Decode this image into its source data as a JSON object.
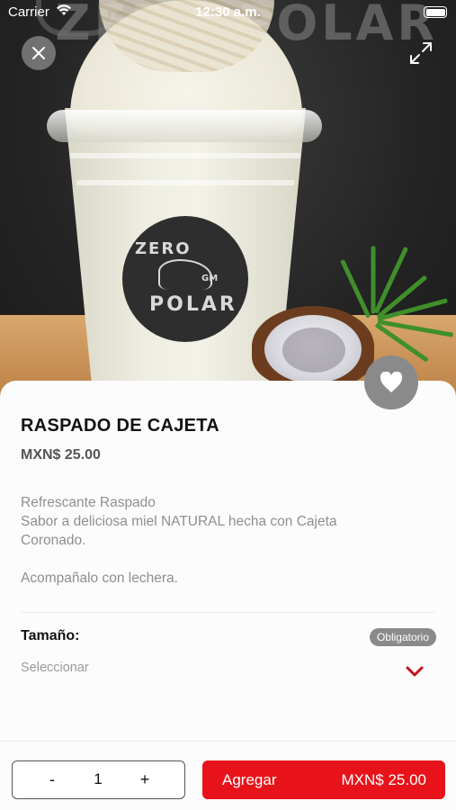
{
  "status_bar": {
    "carrier": "Carrier",
    "time": "12:30 a.m."
  },
  "product": {
    "name": "RASPADO DE CAJETA",
    "price": "MXN$ 25.00",
    "description_lines": [
      "Refrescante Raspado",
      "Sabor a deliciosa miel NATURAL hecha con Cajeta",
      "Coronado.",
      "",
      "Acompañalo con lechera."
    ],
    "image_logo_text": [
      "ZERO",
      "POLAR",
      "GM"
    ]
  },
  "options": {
    "size_label": "Tamaño:",
    "required_badge": "Obligatorio",
    "size_placeholder": "Seleccionar"
  },
  "cart": {
    "minus_label": "-",
    "quantity": "1",
    "plus_label": "+",
    "add_label": "Agregar",
    "add_amount": "MXN$ 25.00"
  },
  "colors": {
    "accent": "#e8131a",
    "badge_bg": "#8a8a8a",
    "chevron": "#c8101a"
  },
  "icons": {
    "close": "close-icon",
    "expand": "expand-icon",
    "favorite": "heart-icon",
    "dropdown": "chevron-down-icon",
    "wifi": "wifi-icon",
    "battery": "battery-icon"
  }
}
